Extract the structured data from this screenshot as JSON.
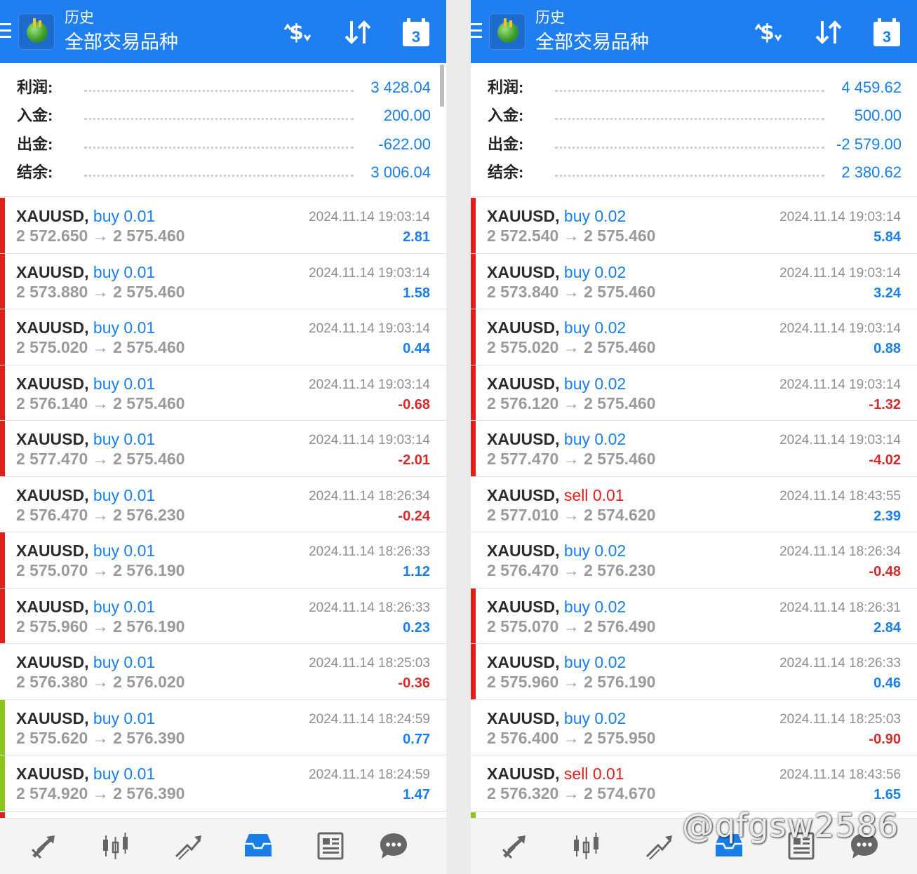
{
  "header": {
    "title": "历史",
    "subtitle": "全部交易品种"
  },
  "colors": {
    "accent": "#1f7ff0",
    "profit_positive": "#1a7ee8",
    "profit_negative": "#d42a2a",
    "buy": "#1a7ee8",
    "sell": "#e0201c",
    "stripe_red": "#e0201c",
    "stripe_green": "#8bc41b"
  },
  "icons": {
    "header": [
      "money-exchange-icon",
      "sort-icon",
      "calendar-icon"
    ],
    "calendar_day": "3",
    "nav": [
      "quotes-icon",
      "chart-candles-icon",
      "trade-icon",
      "history-icon",
      "news-icon",
      "chat-icon"
    ]
  },
  "panels": [
    {
      "summary": [
        {
          "label": "利润:",
          "value": "3 428.04"
        },
        {
          "label": "入金:",
          "value": "200.00"
        },
        {
          "label": "出金:",
          "value": "-622.00"
        },
        {
          "label": "结余:",
          "value": "3 006.04"
        }
      ],
      "trades": [
        {
          "symbol": "XAUUSD,",
          "direction": "buy",
          "volume": "0.01",
          "open": "2 572.650",
          "arrow": "→",
          "close": "2 575.460",
          "time": "2024.11.14 19:03:14",
          "profit": "2.81",
          "stripe": "red"
        },
        {
          "symbol": "XAUUSD,",
          "direction": "buy",
          "volume": "0.01",
          "open": "2 573.880",
          "arrow": "→",
          "close": "2 575.460",
          "time": "2024.11.14 19:03:14",
          "profit": "1.58",
          "stripe": "red"
        },
        {
          "symbol": "XAUUSD,",
          "direction": "buy",
          "volume": "0.01",
          "open": "2 575.020",
          "arrow": "→",
          "close": "2 575.460",
          "time": "2024.11.14 19:03:14",
          "profit": "0.44",
          "stripe": "red"
        },
        {
          "symbol": "XAUUSD,",
          "direction": "buy",
          "volume": "0.01",
          "open": "2 576.140",
          "arrow": "→",
          "close": "2 575.460",
          "time": "2024.11.14 19:03:14",
          "profit": "-0.68",
          "stripe": "red"
        },
        {
          "symbol": "XAUUSD,",
          "direction": "buy",
          "volume": "0.01",
          "open": "2 577.470",
          "arrow": "→",
          "close": "2 575.460",
          "time": "2024.11.14 19:03:14",
          "profit": "-2.01",
          "stripe": "red"
        },
        {
          "symbol": "XAUUSD,",
          "direction": "buy",
          "volume": "0.01",
          "open": "2 576.470",
          "arrow": "→",
          "close": "2 576.230",
          "time": "2024.11.14 18:26:34",
          "profit": "-0.24",
          "stripe": "none"
        },
        {
          "symbol": "XAUUSD,",
          "direction": "buy",
          "volume": "0.01",
          "open": "2 575.070",
          "arrow": "→",
          "close": "2 576.190",
          "time": "2024.11.14 18:26:33",
          "profit": "1.12",
          "stripe": "red"
        },
        {
          "symbol": "XAUUSD,",
          "direction": "buy",
          "volume": "0.01",
          "open": "2 575.960",
          "arrow": "→",
          "close": "2 576.190",
          "time": "2024.11.14 18:26:33",
          "profit": "0.23",
          "stripe": "red"
        },
        {
          "symbol": "XAUUSD,",
          "direction": "buy",
          "volume": "0.01",
          "open": "2 576.380",
          "arrow": "→",
          "close": "2 576.020",
          "time": "2024.11.14 18:25:03",
          "profit": "-0.36",
          "stripe": "none"
        },
        {
          "symbol": "XAUUSD,",
          "direction": "buy",
          "volume": "0.01",
          "open": "2 575.620",
          "arrow": "→",
          "close": "2 576.390",
          "time": "2024.11.14 18:24:59",
          "profit": "0.77",
          "stripe": "green"
        },
        {
          "symbol": "XAUUSD,",
          "direction": "buy",
          "volume": "0.01",
          "open": "2 574.920",
          "arrow": "→",
          "close": "2 576.390",
          "time": "2024.11.14 18:24:59",
          "profit": "1.47",
          "stripe": "green"
        }
      ],
      "partial_stripe": "red"
    },
    {
      "summary": [
        {
          "label": "利润:",
          "value": "4 459.62"
        },
        {
          "label": "入金:",
          "value": "500.00"
        },
        {
          "label": "出金:",
          "value": "-2 579.00"
        },
        {
          "label": "结余:",
          "value": "2 380.62"
        }
      ],
      "trades": [
        {
          "symbol": "XAUUSD,",
          "direction": "buy",
          "volume": "0.02",
          "open": "2 572.540",
          "arrow": "→",
          "close": "2 575.460",
          "time": "2024.11.14 19:03:14",
          "profit": "5.84",
          "stripe": "red"
        },
        {
          "symbol": "XAUUSD,",
          "direction": "buy",
          "volume": "0.02",
          "open": "2 573.840",
          "arrow": "→",
          "close": "2 575.460",
          "time": "2024.11.14 19:03:14",
          "profit": "3.24",
          "stripe": "red"
        },
        {
          "symbol": "XAUUSD,",
          "direction": "buy",
          "volume": "0.02",
          "open": "2 575.020",
          "arrow": "→",
          "close": "2 575.460",
          "time": "2024.11.14 19:03:14",
          "profit": "0.88",
          "stripe": "red"
        },
        {
          "symbol": "XAUUSD,",
          "direction": "buy",
          "volume": "0.02",
          "open": "2 576.120",
          "arrow": "→",
          "close": "2 575.460",
          "time": "2024.11.14 19:03:14",
          "profit": "-1.32",
          "stripe": "red"
        },
        {
          "symbol": "XAUUSD,",
          "direction": "buy",
          "volume": "0.02",
          "open": "2 577.470",
          "arrow": "→",
          "close": "2 575.460",
          "time": "2024.11.14 19:03:14",
          "profit": "-4.02",
          "stripe": "red"
        },
        {
          "symbol": "XAUUSD,",
          "direction": "sell",
          "volume": "0.01",
          "open": "2 577.010",
          "arrow": "→",
          "close": "2 574.620",
          "time": "2024.11.14 18:43:55",
          "profit": "2.39",
          "stripe": "none"
        },
        {
          "symbol": "XAUUSD,",
          "direction": "buy",
          "volume": "0.02",
          "open": "2 576.470",
          "arrow": "→",
          "close": "2 576.230",
          "time": "2024.11.14 18:26:34",
          "profit": "-0.48",
          "stripe": "none"
        },
        {
          "symbol": "XAUUSD,",
          "direction": "buy",
          "volume": "0.02",
          "open": "2 575.070",
          "arrow": "→",
          "close": "2 576.490",
          "time": "2024.11.14 18:26:31",
          "profit": "2.84",
          "stripe": "red"
        },
        {
          "symbol": "XAUUSD,",
          "direction": "buy",
          "volume": "0.02",
          "open": "2 575.960",
          "arrow": "→",
          "close": "2 576.190",
          "time": "2024.11.14 18:26:33",
          "profit": "0.46",
          "stripe": "red"
        },
        {
          "symbol": "XAUUSD,",
          "direction": "buy",
          "volume": "0.02",
          "open": "2 576.400",
          "arrow": "→",
          "close": "2 575.950",
          "time": "2024.11.14 18:25:03",
          "profit": "-0.90",
          "stripe": "none"
        },
        {
          "symbol": "XAUUSD,",
          "direction": "sell",
          "volume": "0.01",
          "open": "2 576.320",
          "arrow": "→",
          "close": "2 574.670",
          "time": "2024.11.14 18:43:56",
          "profit": "1.65",
          "stripe": "none"
        }
      ],
      "partial_stripe": "green"
    }
  ],
  "watermark": "@qfgsw2586"
}
